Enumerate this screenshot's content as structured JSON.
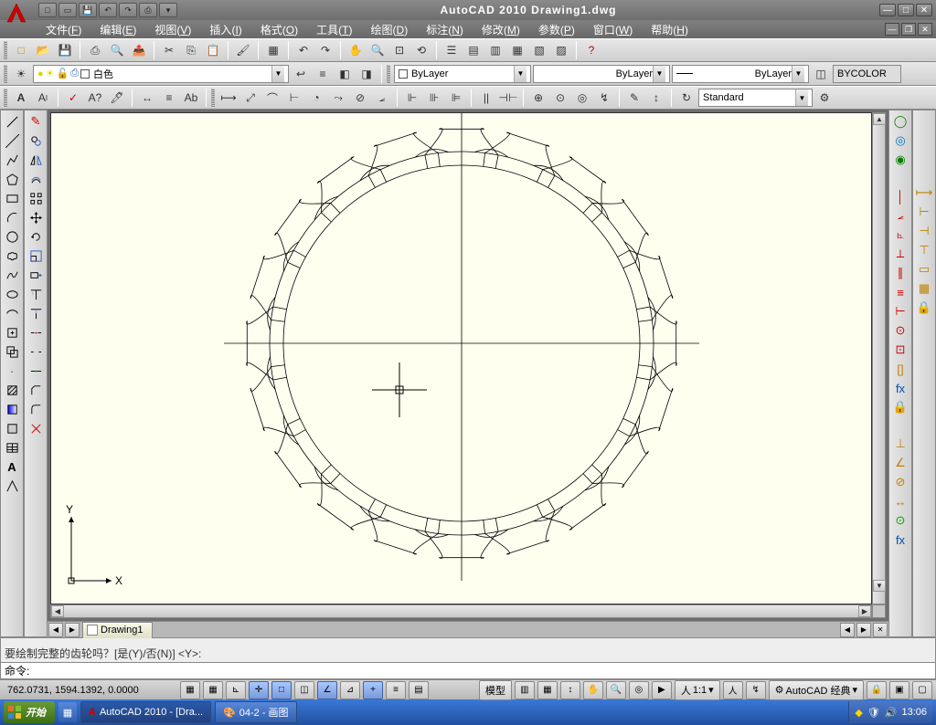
{
  "app": {
    "title": "AutoCAD 2010   Drawing1.dwg"
  },
  "menus": [
    {
      "label": "文件",
      "key": "F"
    },
    {
      "label": "编辑",
      "key": "E"
    },
    {
      "label": "视图",
      "key": "V"
    },
    {
      "label": "插入",
      "key": "I"
    },
    {
      "label": "格式",
      "key": "O"
    },
    {
      "label": "工具",
      "key": "T"
    },
    {
      "label": "绘图",
      "key": "D"
    },
    {
      "label": "标注",
      "key": "N"
    },
    {
      "label": "修改",
      "key": "M"
    },
    {
      "label": "参数",
      "key": "P"
    },
    {
      "label": "窗口",
      "key": "W"
    },
    {
      "label": "帮助",
      "key": "H"
    }
  ],
  "layer_combo": "白色",
  "prop_color": "ByLayer",
  "prop_line": "ByLayer",
  "prop_weight": "ByLayer",
  "prop_bycolor": "BYCOLOR",
  "text_style": "Standard",
  "ucs_x": "X",
  "ucs_y": "Y",
  "doc_tab": "Drawing1",
  "cmd_history": "要绘制完整的齿轮吗？[是(Y)/否(N)] <Y>:",
  "cmd_prompt": "命令:",
  "status": {
    "coords": "762.0731, 1594.1392, 0.0000",
    "model": "模型",
    "scale_label": "人",
    "scale": "1:1",
    "workspace": "AutoCAD 经典"
  },
  "taskbar": {
    "start": "开始",
    "items": [
      "AutoCAD 2010 - [Dra...",
      "04-2 - 画图"
    ],
    "clock": "13:06"
  }
}
